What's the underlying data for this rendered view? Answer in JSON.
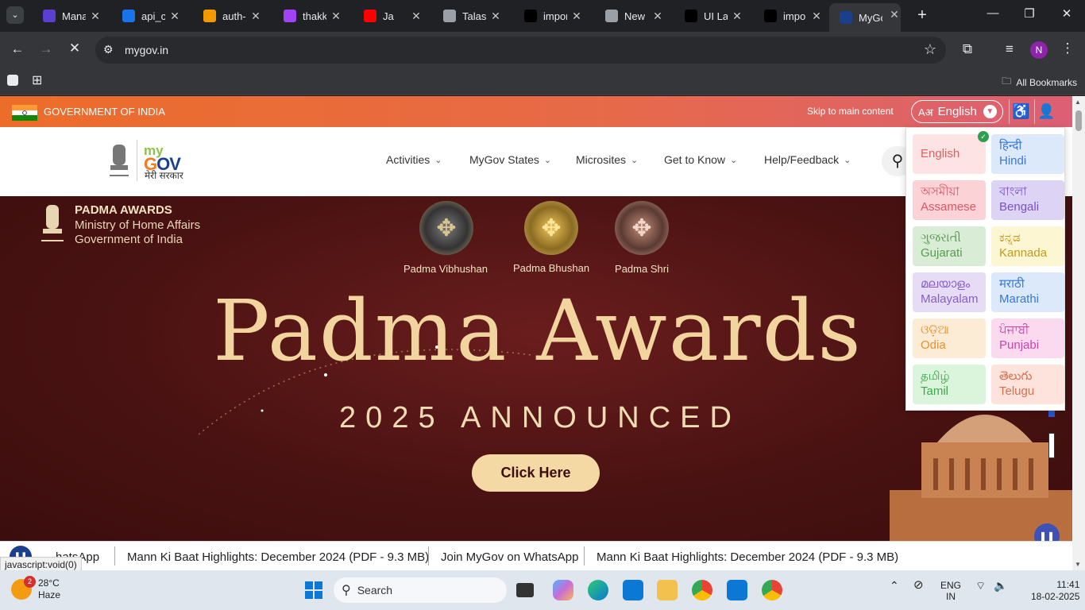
{
  "browser": {
    "tabs": [
      {
        "title": "Mana",
        "icon": "app-icon",
        "color": "#5b3fd1"
      },
      {
        "title": "api_c",
        "icon": "globe-icon",
        "color": "#1a73e8"
      },
      {
        "title": "auth-",
        "icon": "ladder-icon",
        "color": "#f29900"
      },
      {
        "title": "thakk",
        "icon": "heart-icon",
        "color": "#a142f4"
      },
      {
        "title": "Ja",
        "icon": "youtube-icon",
        "color": "#ff0000"
      },
      {
        "title": "Talasa",
        "icon": "globe-icon",
        "color": "#9aa0a6"
      },
      {
        "title": "impor",
        "icon": "github-icon",
        "color": "#000000"
      },
      {
        "title": "New",
        "icon": "chrome-icon",
        "color": "#9aa0a6"
      },
      {
        "title": "UI La",
        "icon": "github-icon",
        "color": "#000000"
      },
      {
        "title": "impo",
        "icon": "openai-icon",
        "color": "#000000"
      },
      {
        "title": "MyGo",
        "icon": "mygov-icon",
        "color": "#1c3f8c"
      }
    ],
    "url": "mygov.in",
    "profile_initial": "N",
    "all_bookmarks": "All Bookmarks"
  },
  "site": {
    "gov_label": "GOVERNMENT OF INDIA",
    "skip_link": "Skip to main content",
    "lang_button": "English",
    "lang_glyph": "Aअ",
    "logo": {
      "my": "my",
      "gov_g": "G",
      "gov_ov": "OV",
      "subtitle": "मेरी सरकार"
    },
    "menu": [
      "Activities",
      "MyGov States",
      "Microsites",
      "Get to Know",
      "Help/Feedback"
    ]
  },
  "hero": {
    "awards_title": "PADMA AWARDS",
    "ministry": "Ministry of Home Affairs",
    "government": "Government of India",
    "medals": [
      "Padma Vibhushan",
      "Padma Bhushan",
      "Padma Shri"
    ],
    "headline": "Padma Awards",
    "subheadline": "2025 ANNOUNCED",
    "cta": "Click Here"
  },
  "ticker": {
    "items": [
      "hatsApp",
      "Mann Ki Baat Highlights: December 2024 (PDF - 9.3 MB)",
      "Join MyGov on WhatsApp",
      "Mann Ki Baat Highlights: December 2024 (PDF - 9.3 MB)"
    ]
  },
  "status_url": "javascript:void(0)",
  "languages": [
    {
      "native": "",
      "english": "English",
      "bg": "#fde3e3",
      "fg": "#e06060",
      "selected": true
    },
    {
      "native": "हिन्दी",
      "english": "Hindi",
      "bg": "#dbe9fb",
      "fg": "#3a78d4"
    },
    {
      "native": "অসমীয়া",
      "english": "Assamese",
      "bg": "#fbd3d6",
      "fg": "#dd5566"
    },
    {
      "native": "বাংলা",
      "english": "Bengali",
      "bg": "#ddd3f5",
      "fg": "#7a4fc8"
    },
    {
      "native": "ગુજરાતી",
      "english": "Gujarati",
      "bg": "#d9ecd6",
      "fg": "#5b9a52"
    },
    {
      "native": "ಕನ್ನಡ",
      "english": "Kannada",
      "bg": "#fdf6d3",
      "fg": "#c29a1b"
    },
    {
      "native": "മലയാളം",
      "english": "Malayalam",
      "bg": "#e6dcf5",
      "fg": "#8a5cc9"
    },
    {
      "native": "मराठी",
      "english": "Marathi",
      "bg": "#dbe9fb",
      "fg": "#3a78d4"
    },
    {
      "native": "ଓଡ଼ିଆ",
      "english": "Odia",
      "bg": "#fdecd5",
      "fg": "#e7902e"
    },
    {
      "native": "ਪੰਜਾਬੀ",
      "english": "Punjabi",
      "bg": "#fbdaf0",
      "fg": "#cc45a5"
    },
    {
      "native": "தமிழ்",
      "english": "Tamil",
      "bg": "#dbf5dc",
      "fg": "#3fa64a"
    },
    {
      "native": "తెలుగు",
      "english": "Telugu",
      "bg": "#fde3dc",
      "fg": "#d7704f"
    }
  ],
  "taskbar": {
    "temp": "28°C",
    "condition": "Haze",
    "weather_badge": "2",
    "search": "Search",
    "lang_top": "ENG",
    "lang_bottom": "IN",
    "time": "11:41",
    "date": "18-02-2025"
  }
}
